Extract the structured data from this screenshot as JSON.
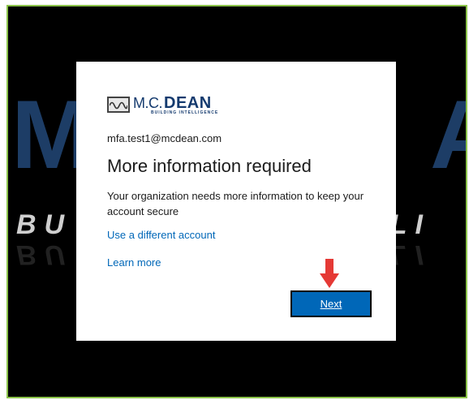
{
  "background": {
    "watermark_left": "M",
    "watermark_right": "A",
    "tag_left": "BU",
    "tag_right": "LLI"
  },
  "logo": {
    "mc": "M.C.",
    "dean": "DEAN",
    "sub": "BUILDING INTELLIGENCE"
  },
  "account": {
    "email": "mfa.test1@mcdean.com"
  },
  "dialog": {
    "title": "More information required",
    "description": "Your organization needs more information to keep your account secure",
    "different_account_link": "Use a different account",
    "learn_more_link": "Learn more",
    "next_button": "Next"
  },
  "colors": {
    "link": "#0067b8",
    "button": "#0067b8",
    "arrow": "#e53935",
    "frame_border": "#8bc34a"
  }
}
